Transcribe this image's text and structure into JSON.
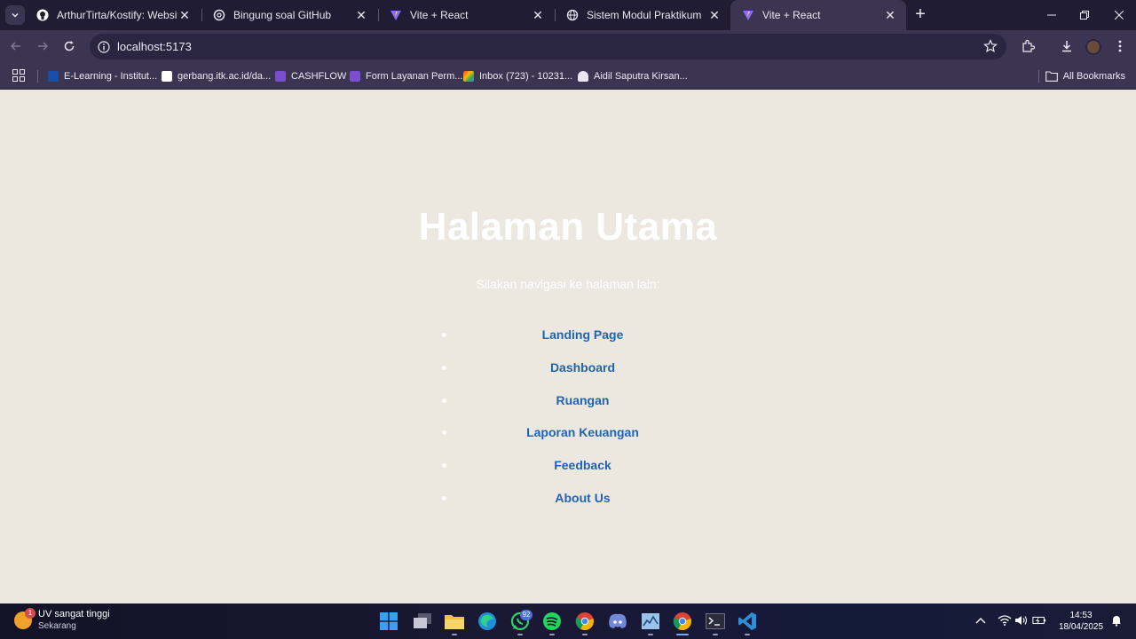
{
  "browser": {
    "tabs": [
      {
        "title": "ArthurTirta/Kostify: Website unt",
        "icon": "github-icon"
      },
      {
        "title": "Bingung soal GitHub",
        "icon": "openai-icon"
      },
      {
        "title": "Vite + React",
        "icon": "vite-icon"
      },
      {
        "title": "Sistem Modul Praktikum",
        "icon": "globe-icon"
      },
      {
        "title": "Vite + React",
        "icon": "vite-icon",
        "active": true
      }
    ],
    "url": "localhost:5173",
    "bookmarks": [
      {
        "label": "E-Learning - Institut...",
        "color": "#1a4fa8"
      },
      {
        "label": "gerbang.itk.ac.id/da...",
        "color": "#ffffff"
      },
      {
        "label": "CASHFLOW",
        "color": "#7a4fcf"
      },
      {
        "label": "Form Layanan Perm...",
        "color": "#7a4fcf"
      },
      {
        "label": "Inbox (723) - 10231...",
        "color": "#d93025"
      },
      {
        "label": "Aidil Saputra Kirsan...",
        "color": "#ffffff"
      }
    ],
    "all_bookmarks": "All Bookmarks"
  },
  "page": {
    "heading": "Halaman Utama",
    "subtitle": "Silakan navigasi ke halaman lain:",
    "links": [
      "Landing Page",
      "Dashboard",
      "Ruangan",
      "Laporan Keuangan",
      "Feedback",
      "About Us"
    ]
  },
  "taskbar": {
    "weather_title": "UV sangat tinggi",
    "weather_sub": "Sekarang",
    "weather_badge": "1",
    "whatsapp_badge": "92",
    "time": "14:53",
    "date": "18/04/2025"
  },
  "colors": {
    "page_bg": "#ede8df",
    "link": "#1e64b4",
    "tabstrip": "#201c33",
    "toolbar": "#3b3552"
  }
}
